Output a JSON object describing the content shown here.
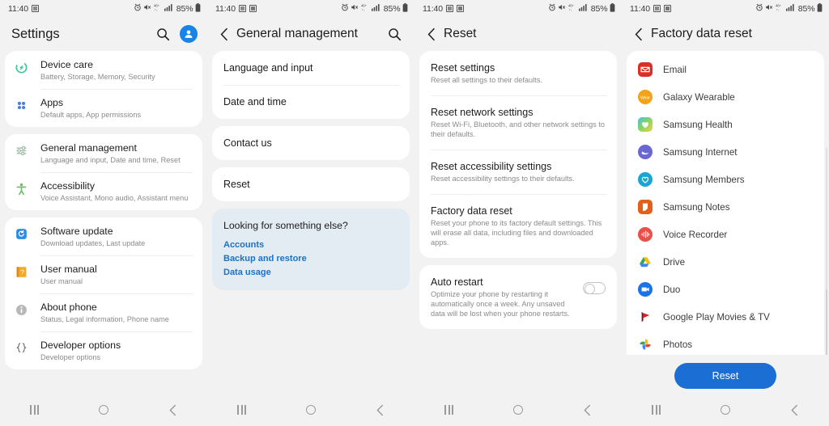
{
  "statusbar": {
    "time": "11:40",
    "battery_percent": "85%",
    "icons_left": [
      "image-icon",
      "screenshot-icon"
    ],
    "icons_right": [
      "alarm-icon",
      "mute-icon",
      "lte-plus-icon",
      "signal-bars-icon",
      "battery-icon"
    ]
  },
  "navbar": {
    "recents_label": "recents-button",
    "home_label": "home-button",
    "back_label": "back-button"
  },
  "panel1": {
    "title": "Settings",
    "search_icon": "search-icon",
    "account_icon": "account-avatar-icon",
    "groups": [
      {
        "items": [
          {
            "title": "Device care",
            "sub": "Battery, Storage, Memory, Security",
            "icon": "device-care-icon"
          },
          {
            "title": "Apps",
            "sub": "Default apps, App permissions",
            "icon": "apps-icon"
          }
        ]
      },
      {
        "items": [
          {
            "title": "General management",
            "sub": "Language and input, Date and time, Reset",
            "icon": "general-management-icon"
          },
          {
            "title": "Accessibility",
            "sub": "Voice Assistant, Mono audio, Assistant menu",
            "icon": "accessibility-icon"
          }
        ]
      },
      {
        "items": [
          {
            "title": "Software update",
            "sub": "Download updates, Last update",
            "icon": "software-update-icon"
          },
          {
            "title": "User manual",
            "sub": "User manual",
            "icon": "user-manual-icon"
          },
          {
            "title": "About phone",
            "sub": "Status, Legal information, Phone name",
            "icon": "about-phone-icon"
          },
          {
            "title": "Developer options",
            "sub": "Developer options",
            "icon": "developer-options-icon"
          }
        ]
      }
    ]
  },
  "panel2": {
    "title": "General management",
    "back_icon": "back-chevron-icon",
    "search_icon": "search-icon",
    "group1": [
      "Language and input",
      "Date and time"
    ],
    "group2": [
      "Contact us"
    ],
    "group3": [
      "Reset"
    ],
    "helper": {
      "title": "Looking for something else?",
      "links": [
        "Accounts",
        "Backup and restore",
        "Data usage"
      ]
    }
  },
  "panel3": {
    "title": "Reset",
    "back_icon": "back-chevron-icon",
    "items": [
      {
        "title": "Reset settings",
        "sub": "Reset all settings to their defaults."
      },
      {
        "title": "Reset network settings",
        "sub": "Reset Wi-Fi, Bluetooth, and other network settings to their defaults."
      },
      {
        "title": "Reset accessibility settings",
        "sub": "Reset accessibility settings to their defaults."
      },
      {
        "title": "Factory data reset",
        "sub": "Reset your phone to its factory default settings. This will erase all data, including files and downloaded apps."
      }
    ],
    "auto_restart": {
      "title": "Auto restart",
      "sub": "Optimize your phone by restarting it automatically once a week. Any unsaved data will be lost when your phone restarts.",
      "enabled": false
    }
  },
  "panel4": {
    "title": "Factory data reset",
    "back_icon": "back-chevron-icon",
    "apps": [
      {
        "name": "Email",
        "icon": "email-icon",
        "color": "#df3c33"
      },
      {
        "name": "Galaxy Wearable",
        "icon": "galaxy-wearable-icon",
        "color": "#f2a31a"
      },
      {
        "name": "Samsung Health",
        "icon": "samsung-health-icon",
        "color": "#7bc86c"
      },
      {
        "name": "Samsung Internet",
        "icon": "samsung-internet-icon",
        "color": "#6a66d4"
      },
      {
        "name": "Samsung Members",
        "icon": "samsung-members-icon",
        "color": "#1aa5d4"
      },
      {
        "name": "Samsung Notes",
        "icon": "samsung-notes-icon",
        "color": "#e2601a"
      },
      {
        "name": "Voice Recorder",
        "icon": "voice-recorder-icon",
        "color": "#e8504a"
      },
      {
        "name": "Drive",
        "icon": "google-drive-icon",
        "color": "#35a853"
      },
      {
        "name": "Duo",
        "icon": "google-duo-icon",
        "color": "#1a73e8"
      },
      {
        "name": "Google Play Movies & TV",
        "icon": "play-movies-icon",
        "color": "#d8202b"
      },
      {
        "name": "Photos",
        "icon": "google-photos-icon",
        "color": "#fbbc04"
      }
    ],
    "reset_button": "Reset"
  }
}
